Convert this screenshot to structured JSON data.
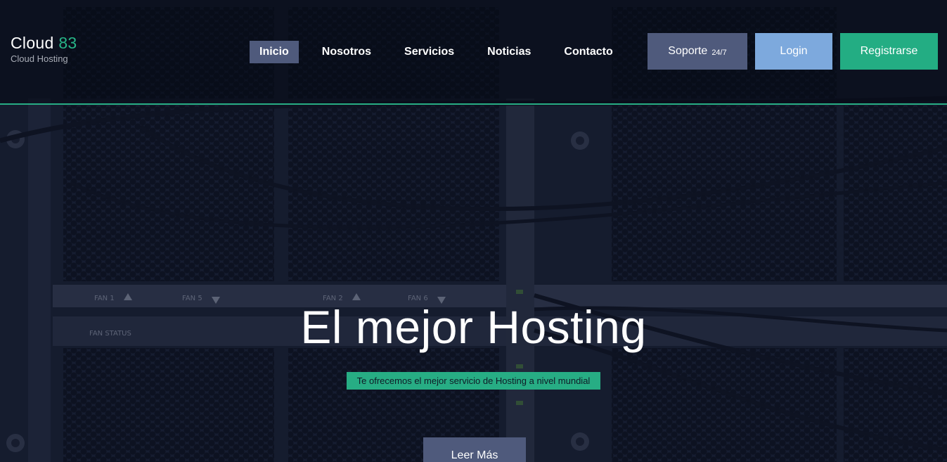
{
  "brand": {
    "name": "Cloud",
    "number": "83",
    "tagline": "Cloud Hosting"
  },
  "nav": {
    "items": [
      {
        "label": "Inicio",
        "active": true
      },
      {
        "label": "Nosotros",
        "active": false
      },
      {
        "label": "Servicios",
        "active": false
      },
      {
        "label": "Noticias",
        "active": false
      },
      {
        "label": "Contacto",
        "active": false
      }
    ]
  },
  "actions": {
    "support_label": "Soporte",
    "support_small": "24/7",
    "login_label": "Login",
    "register_label": "Registrarse"
  },
  "hero": {
    "title": "El mejor Hosting",
    "subtitle": "Te ofrecemos el mejor servicio de Hosting a nivel mundial",
    "cta_label": "Leer Más"
  },
  "background_labels": {
    "fan1": "FAN 1",
    "fan5": "FAN 5",
    "fan2": "FAN 2",
    "fan6": "FAN 6",
    "fan_status": "FAN STATUS"
  },
  "colors": {
    "accent_green": "#27ad84",
    "nav_active": "#4f5a7c",
    "login_blue": "#7da9dd",
    "header_bg": "#050914"
  }
}
